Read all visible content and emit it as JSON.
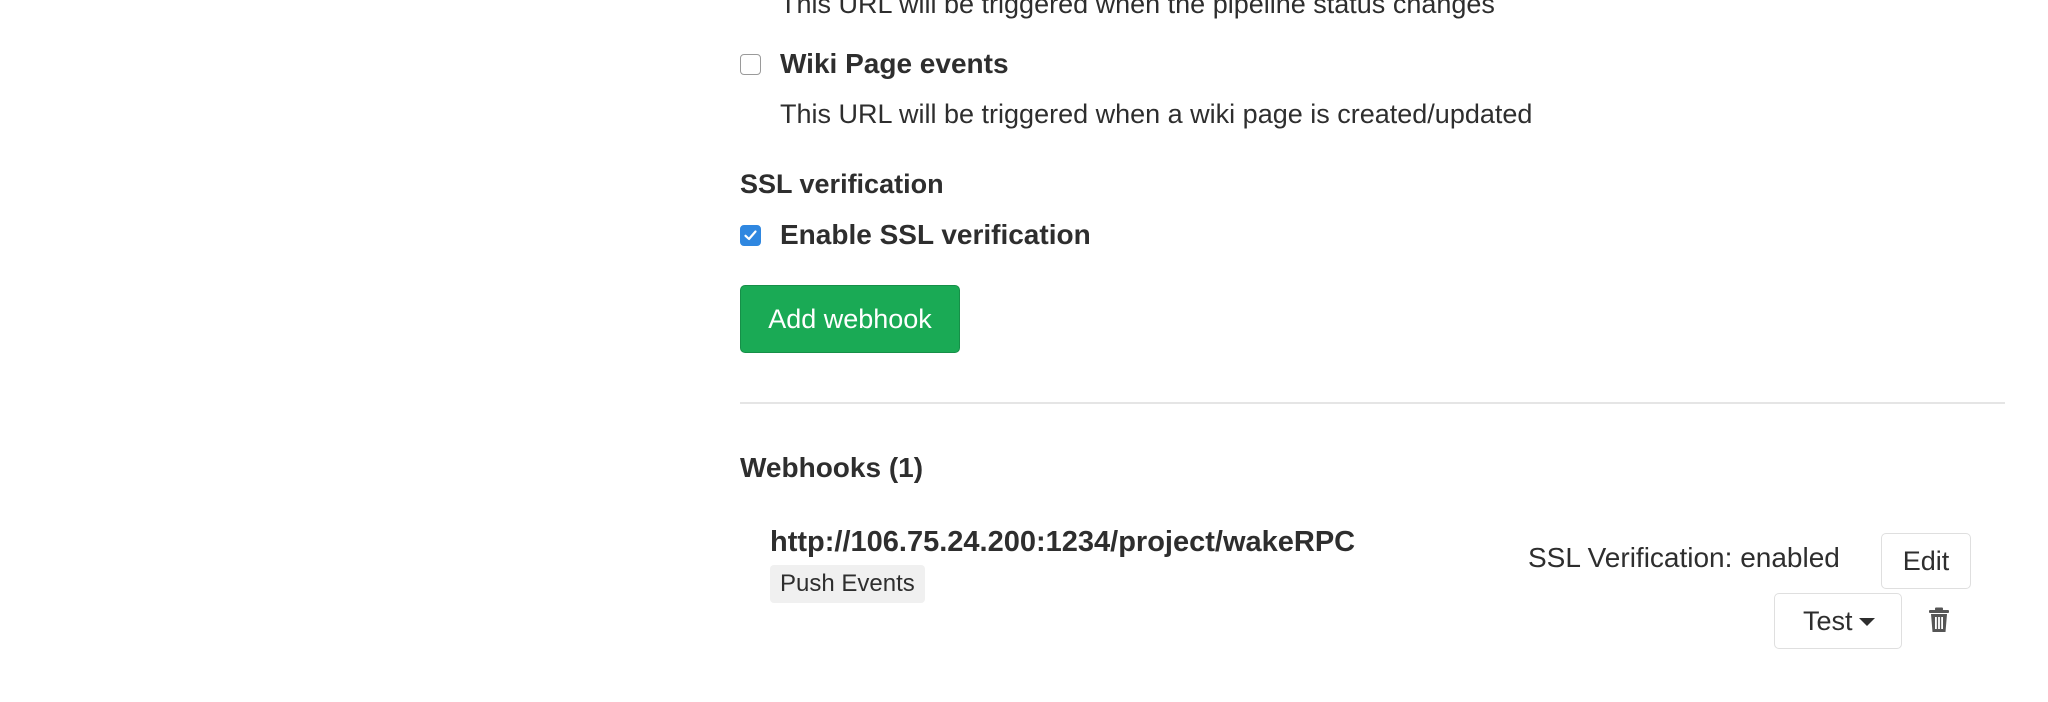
{
  "triggers": {
    "pipeline_help": "This URL will be triggered when the pipeline status changes",
    "wiki_label": "Wiki Page events",
    "wiki_help": "This URL will be triggered when a wiki page is created/updated",
    "wiki_checked": false
  },
  "ssl": {
    "section_label": "SSL verification",
    "checkbox_label": "Enable SSL verification",
    "checked": true
  },
  "form": {
    "submit_label": "Add webhook"
  },
  "webhooks": {
    "title": "Webhooks (1)",
    "items": [
      {
        "url": "http://106.75.24.200:1234/project/wakeRPC",
        "events": [
          "Push Events"
        ],
        "ssl_status": "SSL Verification: enabled",
        "edit_label": "Edit",
        "test_label": "Test",
        "delete_icon": "trash-icon"
      }
    ]
  },
  "colors": {
    "success": "#1aaa55",
    "checkbox_checked": "#2f87e0",
    "text": "#2e2e2e",
    "divider": "#e5e5e5",
    "badge_bg": "#f0f0f0"
  }
}
